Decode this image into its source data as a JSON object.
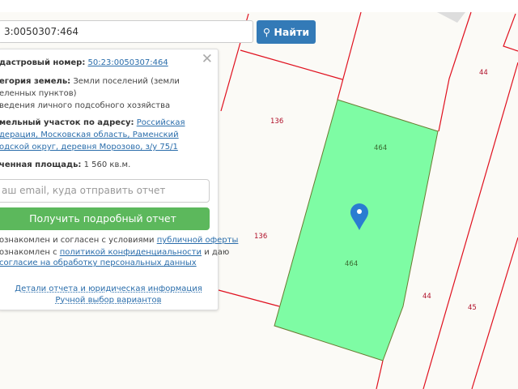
{
  "search": {
    "value": "3:0050307:464",
    "button": "Найти",
    "icon": "search-icon"
  },
  "panel": {
    "cadastral_label": "дастровый номер:",
    "cadastral_value": "50:23:0050307:464",
    "category_label": "егория земель:",
    "category_value": "Земли поселений (земли",
    "category_line2": "еленных пунктов)",
    "category_line3": "ведения личного подсобного хозяйства",
    "address_label": "мельный участок по адресу:",
    "address_line1": "Российская",
    "address_line2": "дерация, Московская область, Раменский",
    "address_line3": "одской округ, деревня Морозово, з/у 75/1",
    "area_label": "ченная площадь:",
    "area_value": "1 560 кв.м.",
    "email_placeholder": "аш email, куда отправить отчет",
    "get_report": "Получить подробный отчет",
    "agree1_text": "ознакомлен и согласен с условиями ",
    "agree1_link": "публичной оферты",
    "agree2_text": "ознакомлен с ",
    "agree2_link": "политикой конфиденциальности",
    "agree2_tail": " и даю",
    "agree3_link": "согласие на обработку персональных данных",
    "details_link": "Детали отчета и юридическая информация",
    "manual_link": "Ручной выбор вариантов"
  },
  "map": {
    "parcel_color": "#7efca4",
    "boundary_color": "#e0101e",
    "labels": [
      "136",
      "136",
      "464",
      "464",
      "44",
      "44",
      "45"
    ]
  }
}
